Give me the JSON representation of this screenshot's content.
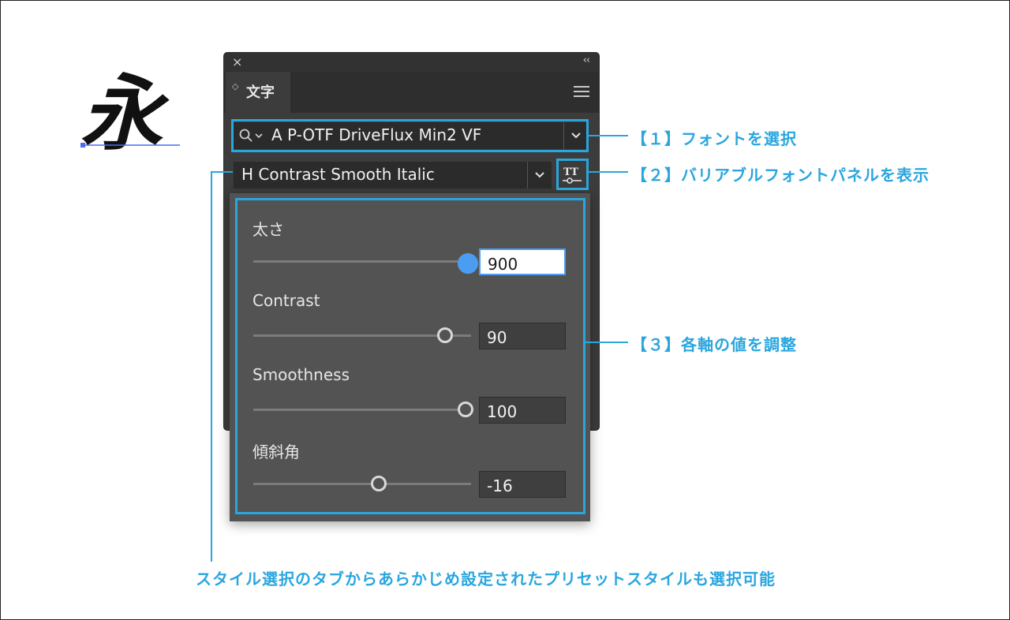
{
  "sample": {
    "glyph": "永"
  },
  "panel": {
    "close_icon": "×",
    "collapse_icon": "‹‹",
    "tab_label": "文字",
    "font_family": "A P-OTF DriveFlux Min2 VF",
    "font_style": "H Contrast Smooth Italic"
  },
  "axes": [
    {
      "label": "太さ",
      "value": "900",
      "position": 1.0,
      "active": true
    },
    {
      "label": "Contrast",
      "value": "90",
      "position": 0.9,
      "active": false
    },
    {
      "label": "Smoothness",
      "value": "100",
      "position": 1.0,
      "active": false
    },
    {
      "label": "傾斜角",
      "value": "-16",
      "position": 0.58,
      "active": false
    }
  ],
  "callouts": {
    "c1": "【１】フォントを選択",
    "c2": "【２】バリアブルフォントパネルを表示",
    "c3": "【３】各軸の値を調整",
    "bottom": "スタイル選択のタブからあらかじめ設定されたプリセットスタイルも選択可能"
  },
  "colors": {
    "accent": "#2aa6de",
    "slider_active": "#4a9df0",
    "panel_bg": "#3c3c3c"
  }
}
